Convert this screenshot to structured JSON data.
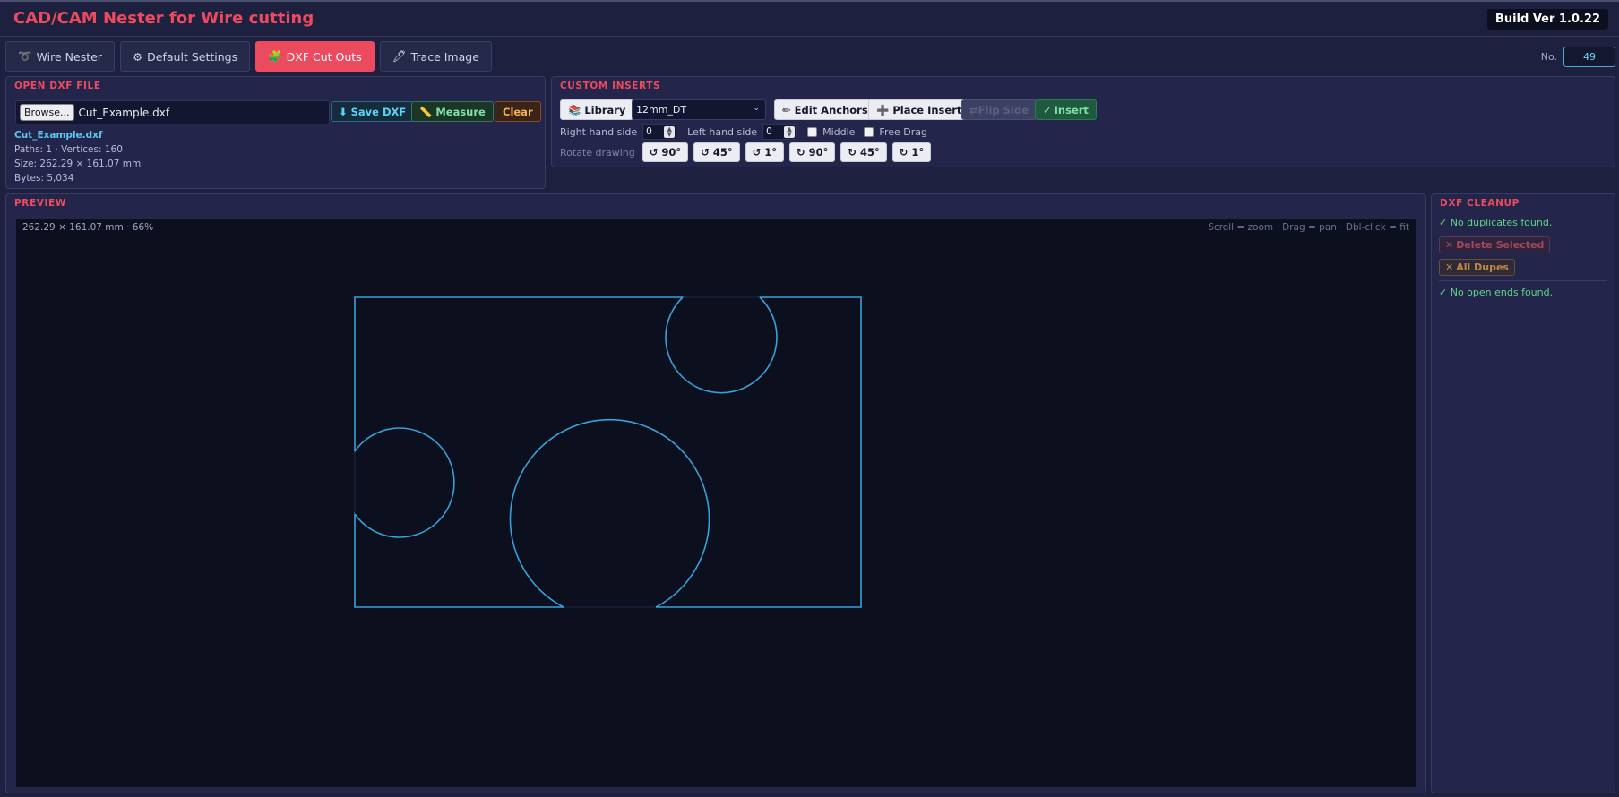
{
  "app": {
    "title": "CAD/CAM Nester for Wire cutting",
    "build": "Build Ver 1.0.22"
  },
  "tabs": [
    {
      "icon": "➰",
      "label": "Wire Nester"
    },
    {
      "icon": "⚙",
      "label": "Default Settings"
    },
    {
      "icon": "🧩",
      "label": "DXF Cut Outs"
    },
    {
      "icon": "🖊",
      "label": "Trace Image"
    }
  ],
  "header_no": {
    "label": "No.",
    "value": "49"
  },
  "open_dxf": {
    "title": "OPEN DXF FILE",
    "browse_label": "Browse...",
    "file_name": "Cut_Example.dxf",
    "save_label": "Save DXF",
    "measure_label": "Measure",
    "clear_label": "Clear",
    "info_file": "Cut_Example.dxf",
    "info_paths": "Paths: 1  ·  Vertices: 160",
    "info_size": "Size: 262.29 × 161.07 mm",
    "info_bytes": "Bytes: 5,034"
  },
  "custom_inserts": {
    "title": "CUSTOM INSERTS",
    "library_label": "Library",
    "insert_select": "12mm_DT",
    "edit_anchors_label": "Edit Anchors",
    "place_insert_label": "Place Insert",
    "flip_side_label": "Flip Side",
    "insert_label": "Insert",
    "right_hand_label": "Right hand side",
    "right_hand_value": "0",
    "left_hand_label": "Left hand side",
    "left_hand_value": "0",
    "middle_label": "Middle",
    "free_drag_label": "Free Drag",
    "rotate_label": "Rotate drawing",
    "rotate_buttons": [
      "↺ 90°",
      "↺ 45°",
      "↺ 1°",
      "↻ 90°",
      "↻ 45°",
      "↻ 1°"
    ]
  },
  "preview": {
    "title": "PREVIEW",
    "info": "262.29 × 161.07 mm  ·  66%",
    "hint": "Scroll = zoom · Drag = pan · Dbl-click = fit",
    "stroke_color": "#3aa0d8"
  },
  "cleanup": {
    "title": "DXF CLEANUP",
    "no_dupes_msg": "✓ No duplicates found.",
    "delete_selected_label": "Delete Selected",
    "all_dupes_label": "All Dupes",
    "no_open_ends_msg": "✓ No open ends found."
  }
}
